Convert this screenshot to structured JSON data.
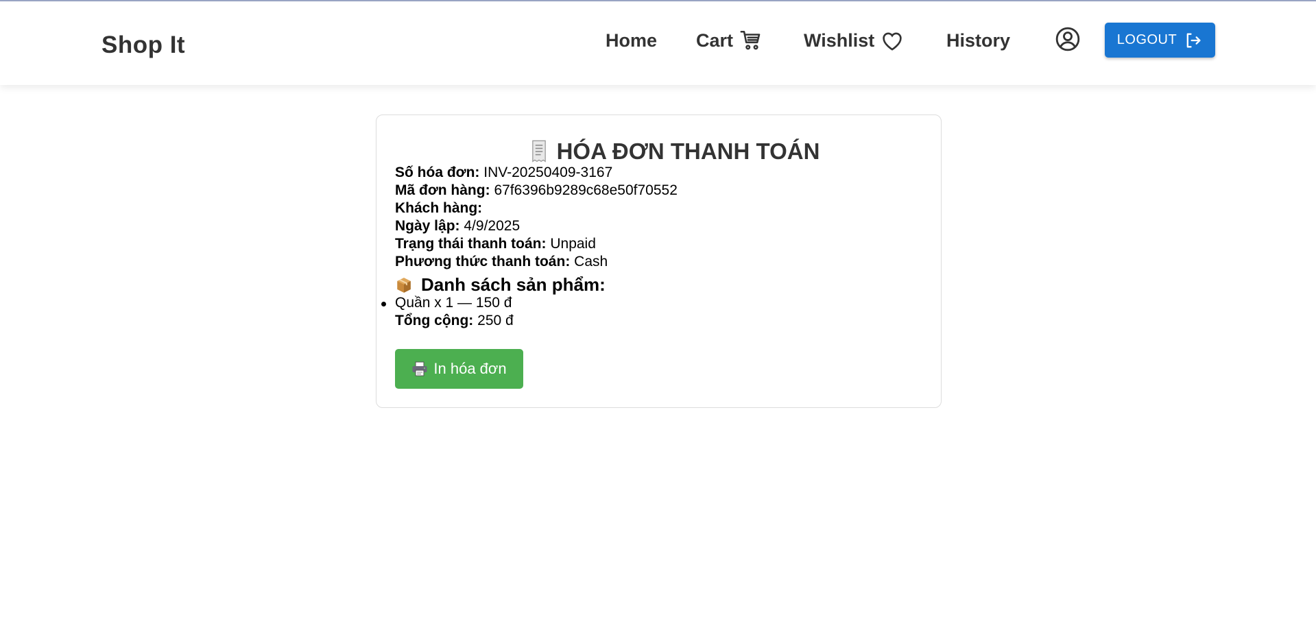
{
  "header": {
    "brand": "Shop It",
    "nav": {
      "home": "Home",
      "cart": "Cart",
      "wishlist": "Wishlist",
      "history": "History"
    },
    "logout_label": "LOGOUT",
    "accent_color": "#1976d2"
  },
  "invoice": {
    "title": "HÓA ĐƠN THANH TOÁN",
    "fields": [
      {
        "label": "Số hóa đơn:",
        "value": "INV-20250409-3167"
      },
      {
        "label": "Mã đơn hàng:",
        "value": "67f6396b9289c68e50f70552"
      },
      {
        "label": "Khách hàng:",
        "value": ""
      },
      {
        "label": "Ngày lập:",
        "value": "4/9/2025"
      },
      {
        "label": "Trạng thái thanh toán:",
        "value": "Unpaid"
      },
      {
        "label": "Phương thức thanh toán:",
        "value": "Cash"
      }
    ],
    "products_heading": "Danh sách sản phẩm:",
    "products": [
      {
        "text": "Quần x 1 — 150 đ"
      }
    ],
    "total_label": "Tổng cộng:",
    "total_value": "250 đ",
    "print_label": "In hóa đơn",
    "print_color": "#4caf50"
  },
  "icons": [
    "receipt-icon",
    "box-icon",
    "printer-icon",
    "cart-icon",
    "heart-icon",
    "user-circle-icon",
    "logout-icon"
  ]
}
